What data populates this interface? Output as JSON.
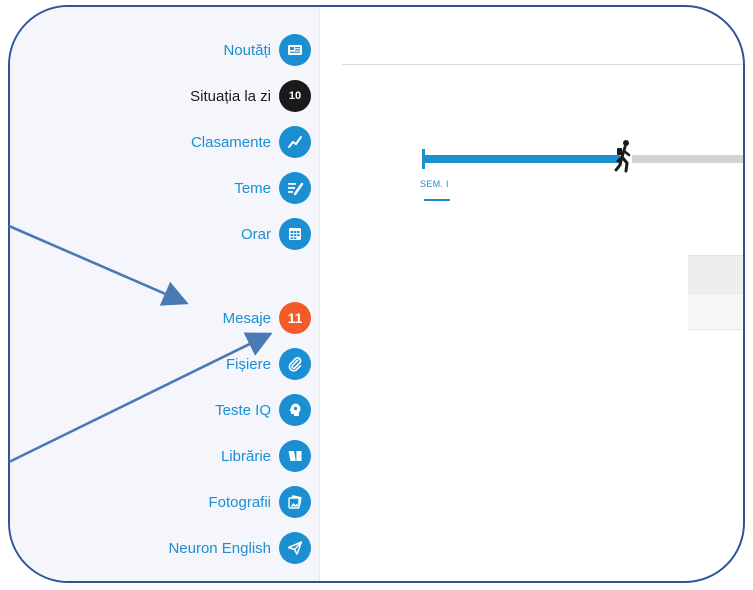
{
  "sidebar": {
    "items": [
      {
        "label": "Noutăți",
        "icon": "news-icon",
        "color": "#1b8fd1"
      },
      {
        "label": "Situația la zi",
        "icon": "grades-icon",
        "color": "#1a1a1a",
        "icon_text": "10"
      },
      {
        "label": "Clasamente",
        "icon": "trend-chart-icon",
        "color": "#1b8fd1"
      },
      {
        "label": "Teme",
        "icon": "homework-icon",
        "color": "#1b8fd1"
      },
      {
        "label": "Orar",
        "icon": "timetable-icon",
        "color": "#1b8fd1"
      },
      {
        "label": "Mesaje",
        "icon": "messages-badge",
        "color": "#f25a2a",
        "badge": "11"
      },
      {
        "label": "Fișiere",
        "icon": "paperclip-icon",
        "color": "#1b8fd1"
      },
      {
        "label": "Teste IQ",
        "icon": "brain-icon",
        "color": "#1b8fd1"
      },
      {
        "label": "Librărie",
        "icon": "book-icon",
        "color": "#1b8fd1"
      },
      {
        "label": "Fotografii",
        "icon": "photos-icon",
        "color": "#1b8fd1"
      },
      {
        "label": "Neuron English",
        "icon": "paper-plane-icon",
        "color": "#1b8fd1"
      }
    ]
  },
  "timeline": {
    "semester_label": "SEM. I",
    "progress_fraction": 0.45,
    "fill_color": "#1b8fd1",
    "track_color": "#d3d3d3"
  },
  "colors": {
    "accent": "#1b8fd1",
    "badge": "#f25a2a",
    "annotation": "#4a7ab5",
    "frame": "#2f5597"
  }
}
